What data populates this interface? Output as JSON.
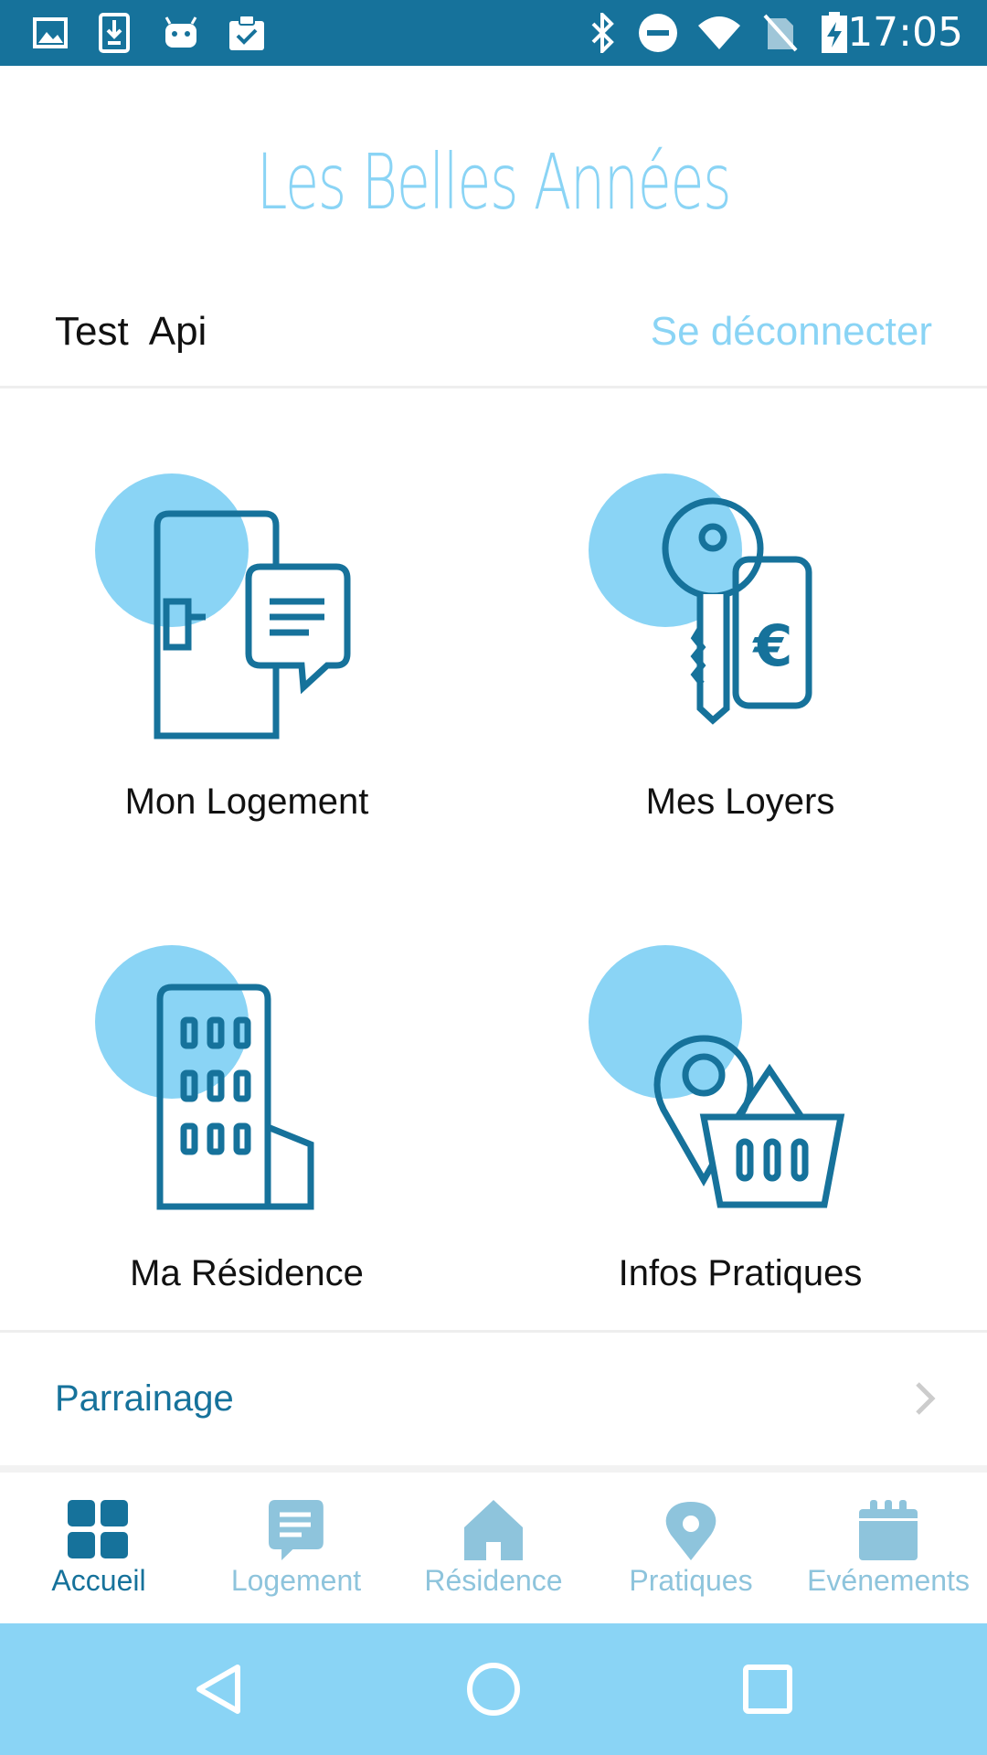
{
  "status_bar": {
    "time": "17:05",
    "left_icons": [
      "image-icon",
      "download-icon",
      "android-icon",
      "clipboard-check-icon"
    ],
    "right_icons": [
      "bluetooth-icon",
      "do-not-disturb-icon",
      "wifi-icon",
      "no-sim-icon",
      "battery-charging-icon"
    ]
  },
  "header": {
    "app_title": "Les Belles Années",
    "user_name": "Test  Api",
    "logout_label": "Se déconnecter"
  },
  "tiles": [
    {
      "label": "Mon Logement",
      "icon": "door-chat-icon"
    },
    {
      "label": "Mes Loyers",
      "icon": "key-euro-icon"
    },
    {
      "label": "Ma Résidence",
      "icon": "building-icon"
    },
    {
      "label": "Infos Pratiques",
      "icon": "pin-basket-icon"
    }
  ],
  "parrainage": {
    "label": "Parrainage",
    "icon": "chevron-right-icon"
  },
  "bottom_nav": [
    {
      "label": "Accueil",
      "icon": "grid-icon",
      "active": true
    },
    {
      "label": "Logement",
      "icon": "chat-icon",
      "active": false
    },
    {
      "label": "Résidence",
      "icon": "home-icon",
      "active": false
    },
    {
      "label": "Pratiques",
      "icon": "map-pin-icon",
      "active": false
    },
    {
      "label": "Evénements",
      "icon": "calendar-icon",
      "active": false
    }
  ],
  "system_nav": [
    "back-icon",
    "home-circle-icon",
    "recents-icon"
  ],
  "colors": {
    "primary": "#16729b",
    "accent": "#8ad4f5",
    "inactive_nav": "#8ec4dc"
  }
}
